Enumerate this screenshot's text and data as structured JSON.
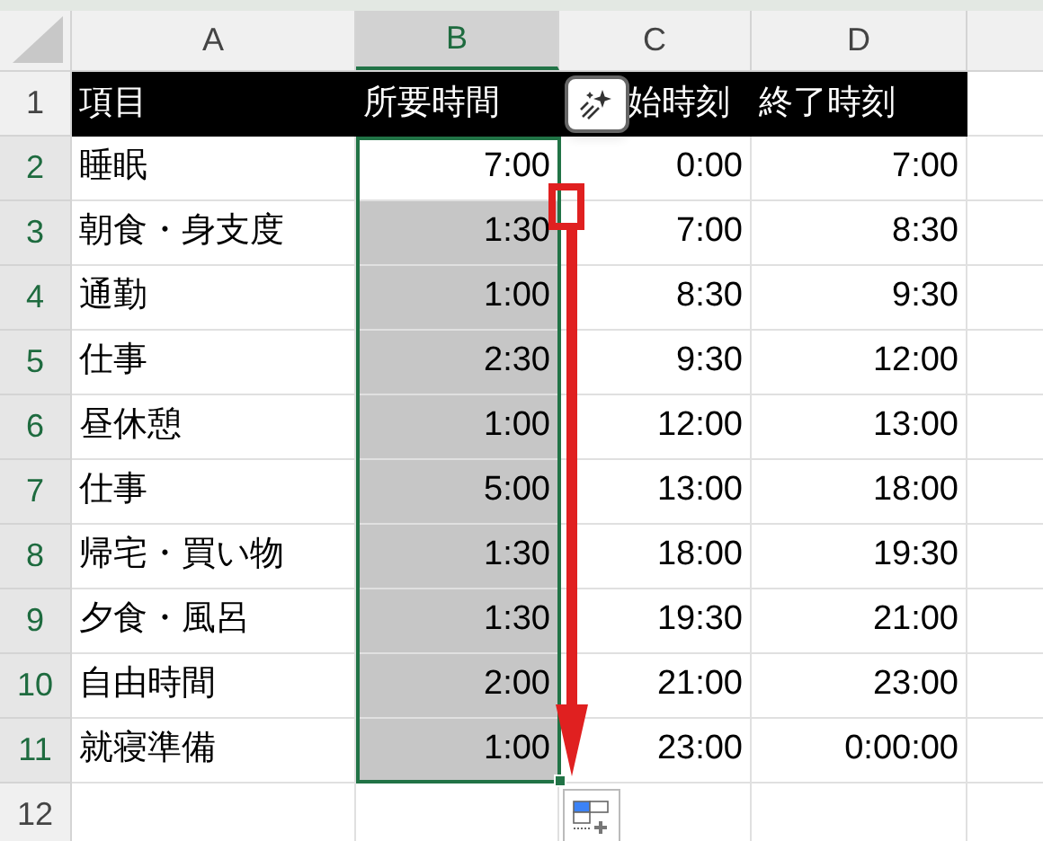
{
  "columns": [
    {
      "label": "A",
      "selected": false
    },
    {
      "label": "B",
      "selected": true
    },
    {
      "label": "C",
      "selected": false
    },
    {
      "label": "D",
      "selected": false
    }
  ],
  "header_row": {
    "number": "1",
    "selected": false,
    "cells": [
      "項目",
      "所要時間",
      "始時刻",
      "終了時刻"
    ]
  },
  "rows": [
    {
      "number": "2",
      "selected": true,
      "active": true,
      "cells": [
        "睡眠",
        "7:00",
        "0:00",
        "7:00"
      ]
    },
    {
      "number": "3",
      "selected": true,
      "active": false,
      "cells": [
        "朝食・身支度",
        "1:30",
        "7:00",
        "8:30"
      ]
    },
    {
      "number": "4",
      "selected": true,
      "active": false,
      "cells": [
        "通勤",
        "1:00",
        "8:30",
        "9:30"
      ]
    },
    {
      "number": "5",
      "selected": true,
      "active": false,
      "cells": [
        "仕事",
        "2:30",
        "9:30",
        "12:00"
      ]
    },
    {
      "number": "6",
      "selected": true,
      "active": false,
      "cells": [
        "昼休憩",
        "1:00",
        "12:00",
        "13:00"
      ]
    },
    {
      "number": "7",
      "selected": true,
      "active": false,
      "cells": [
        "仕事",
        "5:00",
        "13:00",
        "18:00"
      ]
    },
    {
      "number": "8",
      "selected": true,
      "active": false,
      "cells": [
        "帰宅・買い物",
        "1:30",
        "18:00",
        "19:30"
      ]
    },
    {
      "number": "9",
      "selected": true,
      "active": false,
      "cells": [
        "夕食・風呂",
        "1:30",
        "19:30",
        "21:00"
      ]
    },
    {
      "number": "10",
      "selected": true,
      "active": false,
      "cells": [
        "自由時間",
        "2:00",
        "21:00",
        "23:00"
      ]
    },
    {
      "number": "11",
      "selected": true,
      "active": false,
      "cells": [
        "就寝準備",
        "1:00",
        "23:00",
        "0:00:00"
      ]
    },
    {
      "number": "12",
      "selected": false,
      "cells": []
    }
  ]
}
